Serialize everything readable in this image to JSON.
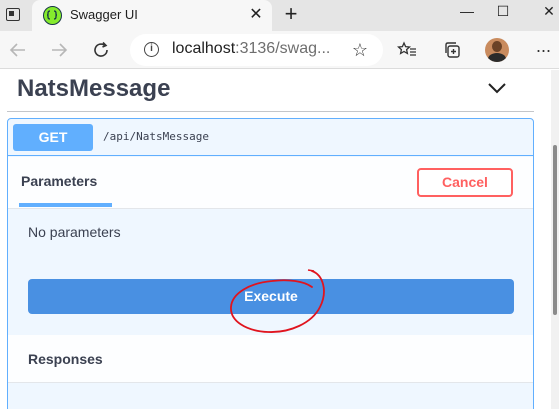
{
  "browser": {
    "tab_title": "Swagger UI",
    "tab_close": "✕",
    "new_tab": "+",
    "window_controls": {
      "minimize": "—",
      "maximize": "☐",
      "close": "✕"
    },
    "url_host": "localhost",
    "url_rest": ":3136/swag...",
    "icons": [
      "back-icon",
      "forward-icon",
      "refresh-icon",
      "info-icon",
      "add-favorite-icon",
      "favorites-icon",
      "collections-icon",
      "profile-avatar",
      "menu-icon"
    ]
  },
  "swagger": {
    "section_title": "NatsMessage",
    "operation": {
      "method": "GET",
      "path": "/api/NatsMessage",
      "method_color": "#61affe"
    },
    "parameters_tab": "Parameters",
    "cancel_label": "Cancel",
    "no_parameters": "No parameters",
    "execute_label": "Execute",
    "responses_title": "Responses",
    "annotation": "red hand-drawn circle around Execute button"
  },
  "colors": {
    "get_blue": "#61affe",
    "execute_blue": "#4990e2",
    "cancel_red": "#ff6060",
    "annotation_red": "#e0141e"
  }
}
